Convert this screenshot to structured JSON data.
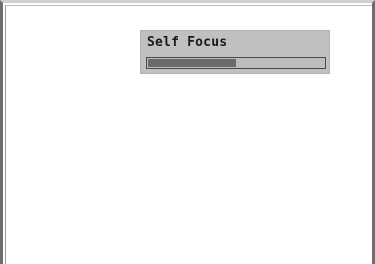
{
  "dialog": {
    "title": "Self Focus",
    "progress": 0.5
  }
}
